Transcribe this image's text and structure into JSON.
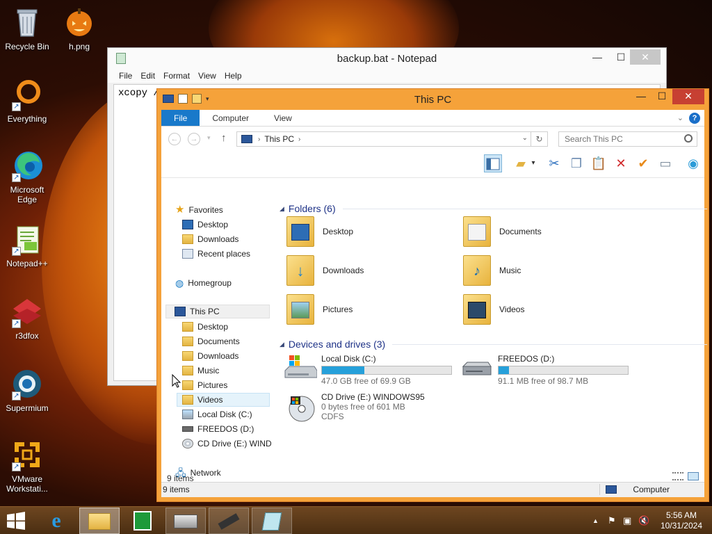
{
  "desktop": {
    "icons": [
      {
        "label": "Recycle Bin"
      },
      {
        "label": "h.png"
      },
      {
        "label": "Everything"
      },
      {
        "label": "Microsoft Edge"
      },
      {
        "label": "Notepad++"
      },
      {
        "label": "r3dfox"
      },
      {
        "label": "Supermium"
      },
      {
        "label": "VMware Workstati..."
      }
    ]
  },
  "notepad": {
    "title": "backup.bat - Notepad",
    "menu": [
      "File",
      "Edit",
      "Format",
      "View",
      "Help"
    ],
    "content": "xcopy /"
  },
  "explorer": {
    "title": "This PC",
    "ribbon_tabs": [
      "File",
      "Computer",
      "View"
    ],
    "address": {
      "crumb": "This PC"
    },
    "search_placeholder": "Search This PC",
    "nav": {
      "favorites": "Favorites",
      "fav_items": [
        "Desktop",
        "Downloads",
        "Recent places"
      ],
      "homegroup": "Homegroup",
      "this_pc": "This PC",
      "pc_items": [
        "Desktop",
        "Documents",
        "Downloads",
        "Music",
        "Pictures",
        "Videos",
        "Local Disk (C:)",
        "FREEDOS (D:)",
        "CD Drive (E:) WINDC"
      ],
      "network": "Network"
    },
    "folders_header": "Folders (6)",
    "folders": [
      "Desktop",
      "Documents",
      "Downloads",
      "Music",
      "Pictures",
      "Videos"
    ],
    "drives_header": "Devices and drives (3)",
    "drives": [
      {
        "name": "Local Disk (C:)",
        "free": "47.0 GB free of 69.9 GB",
        "used_fraction": 0.33
      },
      {
        "name": "FREEDOS (D:)",
        "free": "91.1 MB free of 98.7 MB",
        "used_fraction": 0.08
      },
      {
        "name": "CD Drive (E:) WINDOWS95",
        "free": "0 bytes free of 601 MB",
        "fs": "CDFS"
      }
    ],
    "item_count_inner": "9 items",
    "status_left": "9 items",
    "status_right": "Computer",
    "accent": "#f5a23a"
  },
  "taskbar": {
    "time": "5:56 AM",
    "date": "10/31/2024"
  }
}
